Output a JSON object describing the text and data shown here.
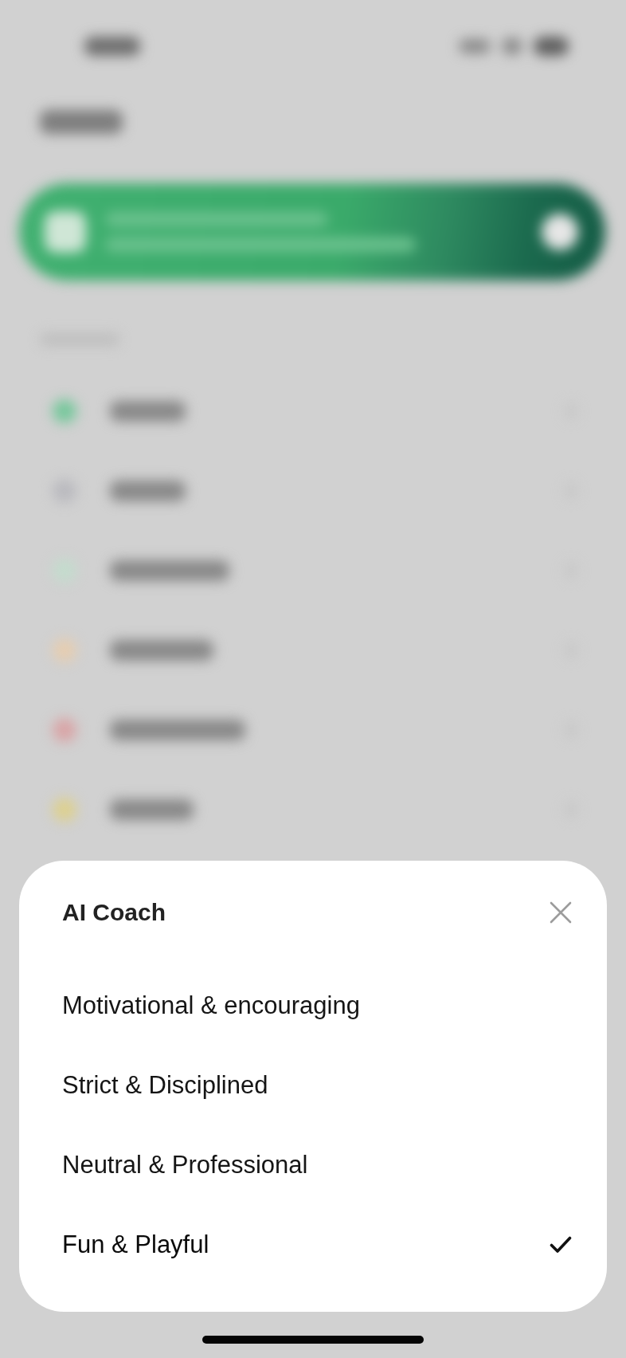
{
  "sheet": {
    "title": "AI Coach",
    "options": [
      {
        "label": "Motivational & encouraging",
        "selected": false
      },
      {
        "label": "Strict & Disciplined",
        "selected": false
      },
      {
        "label": "Neutral & Professional",
        "selected": false
      },
      {
        "label": "Fun & Playful",
        "selected": true
      }
    ]
  }
}
